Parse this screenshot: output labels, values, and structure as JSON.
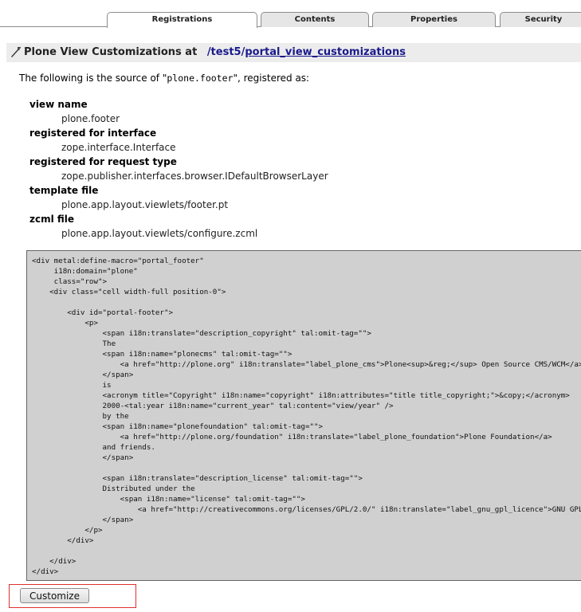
{
  "tabs": [
    {
      "label": "Registrations",
      "active": true
    },
    {
      "label": "Contents",
      "active": false
    },
    {
      "label": "Properties",
      "active": false
    },
    {
      "label": "Security",
      "active": false
    }
  ],
  "header": {
    "title": "Plone View Customizations at",
    "path_prefix": "/test5/",
    "path_link": "portal_view_customizations",
    "icon": "wrench-icon"
  },
  "intro": {
    "before": "The following is the source of \"",
    "code": "plone.footer",
    "after": "\", registered as:"
  },
  "properties": [
    {
      "label": "view name",
      "value": "plone.footer"
    },
    {
      "label": "registered for interface",
      "value": "zope.interface.Interface"
    },
    {
      "label": "registered for request type",
      "value": "zope.publisher.interfaces.browser.IDefaultBrowserLayer"
    },
    {
      "label": "template file",
      "value": "plone.app.layout.viewlets/footer.pt"
    },
    {
      "label": "zcml file",
      "value": "plone.app.layout.viewlets/configure.zcml"
    }
  ],
  "source_code": "<div metal:define-macro=\"portal_footer\"\n     i18n:domain=\"plone\"\n     class=\"row\">\n    <div class=\"cell width-full position-0\">\n\n        <div id=\"portal-footer\">\n            <p>\n                <span i18n:translate=\"description_copyright\" tal:omit-tag=\"\">\n                The\n                <span i18n:name=\"plonecms\" tal:omit-tag=\"\">\n                    <a href=\"http://plone.org\" i18n:translate=\"label_plone_cms\">Plone<sup>&reg;</sup> Open Source CMS/WCM</a>\n                </span>\n                is\n                <acronym title=\"Copyright\" i18n:name=\"copyright\" i18n:attributes=\"title title_copyright;\">&copy;</acronym>\n                2000-<tal:year i18n:name=\"current_year\" tal:content=\"view/year\" />\n                by the\n                <span i18n:name=\"plonefoundation\" tal:omit-tag=\"\">\n                    <a href=\"http://plone.org/foundation\" i18n:translate=\"label_plone_foundation\">Plone Foundation</a>\n                and friends.\n                </span>\n\n                <span i18n:translate=\"description_license\" tal:omit-tag=\"\">\n                Distributed under the\n                    <span i18n:name=\"license\" tal:omit-tag=\"\">\n                        <a href=\"http://creativecommons.org/licenses/GPL/2.0/\" i18n:translate=\"label_gnu_gpl_licence\">GNU GPL license</a>.\n                </span>\n            </p>\n        </div>\n\n    </div>\n</div>",
  "customize": {
    "label": "Customize"
  },
  "colors": {
    "highlight_border": "#e03030",
    "code_background": "#d0d0d0",
    "link": "#1a1a8c"
  }
}
